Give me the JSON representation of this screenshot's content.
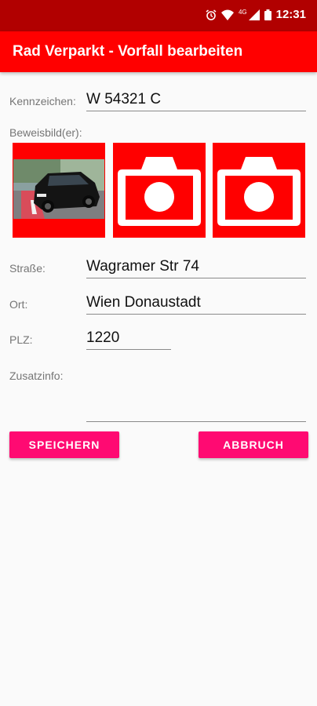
{
  "status_bar": {
    "time": "12:31",
    "network": "4G",
    "icons": [
      "alarm-icon",
      "wifi-icon",
      "signal-icon",
      "battery-icon"
    ]
  },
  "app_bar": {
    "title": "Rad Verparkt - Vorfall bearbeiten"
  },
  "form": {
    "kennzeichen": {
      "label": "Kennzeichen:",
      "value": "W 54321 C"
    },
    "beweisbilder": {
      "label": "Beweisbild(er):",
      "photos": [
        {
          "type": "photo-thumbnail"
        },
        {
          "type": "camera-placeholder",
          "icon": "camera-icon"
        },
        {
          "type": "camera-placeholder",
          "icon": "camera-icon"
        }
      ]
    },
    "strasse": {
      "label": "Straße:",
      "value": "Wagramer Str 74"
    },
    "ort": {
      "label": "Ort:",
      "value": "Wien Donaustadt"
    },
    "plz": {
      "label": "PLZ:",
      "value": "1220"
    },
    "zusatzinfo": {
      "label": "Zusatzinfo:",
      "value": ""
    }
  },
  "buttons": {
    "save": "SPEICHERN",
    "cancel": "ABBRUCH"
  },
  "colors": {
    "status_bar": "#b10000",
    "app_bar": "#ff0000",
    "photo_frame": "#ff0000",
    "button": "#ff0a72",
    "background": "#fafafa"
  }
}
